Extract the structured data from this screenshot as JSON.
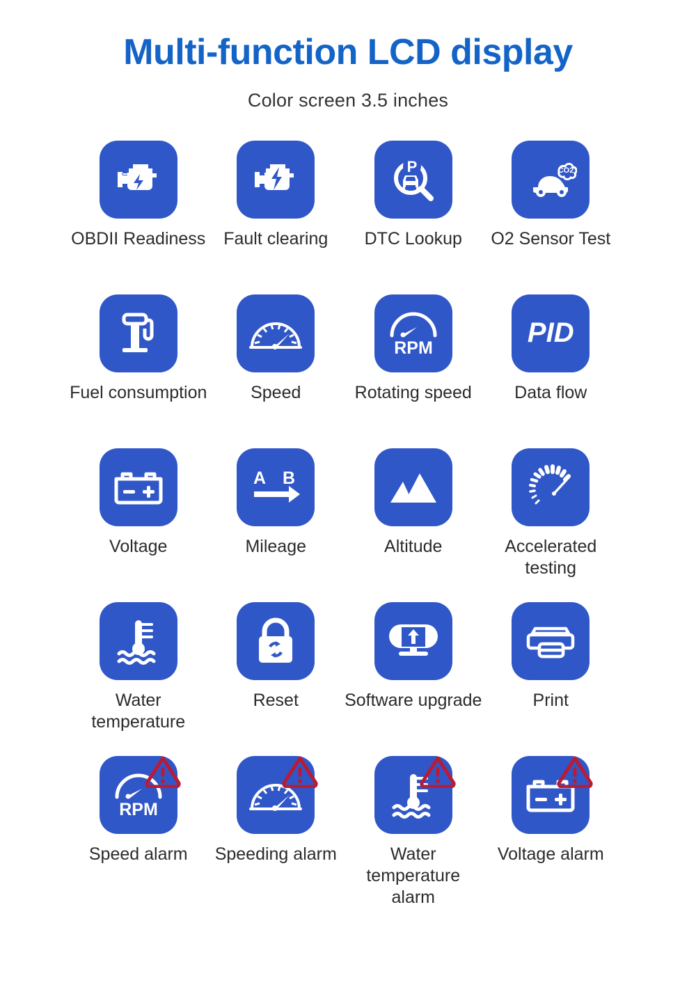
{
  "header": {
    "title": "Multi-function LCD display",
    "subtitle": "Color screen 3.5 inches",
    "title_color": "#1464c8",
    "subtitle_color": "#333333"
  },
  "theme": {
    "tile_blue": "#3057c7",
    "icon_white": "#ffffff",
    "alarm_red": "#b81c35",
    "page_background": "#ffffff"
  },
  "features": [
    {
      "label": "OBDII Readiness",
      "icon": "engine-icon",
      "alarm": false
    },
    {
      "label": "Fault clearing",
      "icon": "engine-bolt-icon",
      "alarm": false
    },
    {
      "label": "DTC Lookup",
      "icon": "magnifier-car-p-icon",
      "alarm": false
    },
    {
      "label": "O2 Sensor Test",
      "icon": "car-co2-cloud-icon",
      "alarm": false
    },
    {
      "label": "Fuel consumption",
      "icon": "fuel-pump-icon",
      "alarm": false
    },
    {
      "label": "Speed",
      "icon": "speedometer-icon",
      "alarm": false
    },
    {
      "label": "Rotating speed",
      "icon": "rpm-gauge-icon",
      "alarm": false
    },
    {
      "label": "Data flow",
      "icon": "pid-text-icon",
      "alarm": false,
      "icon_text": "PID"
    },
    {
      "label": "Voltage",
      "icon": "battery-icon",
      "alarm": false
    },
    {
      "label": "Mileage",
      "icon": "a-b-arrow-icon",
      "alarm": false,
      "icon_text_a": "A",
      "icon_text_b": "B"
    },
    {
      "label": "Altitude",
      "icon": "mountains-icon",
      "alarm": false
    },
    {
      "label": "Accelerated testing",
      "icon": "tick-gauge-icon",
      "alarm": false
    },
    {
      "label": "Water temperature",
      "icon": "thermometer-water-icon",
      "alarm": false
    },
    {
      "label": "Reset",
      "icon": "lock-refresh-icon",
      "alarm": false
    },
    {
      "label": "Software upgrade",
      "icon": "monitor-upload-icon",
      "alarm": false
    },
    {
      "label": "Print",
      "icon": "printer-icon",
      "alarm": false
    },
    {
      "label": "Speed alarm",
      "icon": "rpm-gauge-icon",
      "alarm": true
    },
    {
      "label": "Speeding alarm",
      "icon": "speedometer-icon",
      "alarm": true
    },
    {
      "label": "Water\ntemperature alarm",
      "icon": "thermometer-water-icon",
      "alarm": true
    },
    {
      "label": "Voltage alarm",
      "icon": "battery-icon",
      "alarm": true
    }
  ]
}
